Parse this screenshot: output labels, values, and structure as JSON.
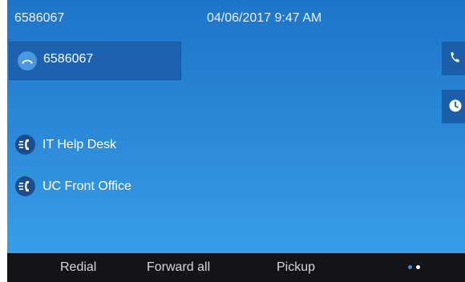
{
  "status_bar": {
    "extension": "6586067",
    "datetime": "04/06/2017 9:47 AM"
  },
  "line_key": {
    "label": "6586067",
    "icon": "handset-icon"
  },
  "features": [
    {
      "label": "IT Help Desk",
      "icon": "line-status-icon"
    },
    {
      "label": "UC Front Office",
      "icon": "line-status-icon"
    }
  ],
  "side_tabs": [
    {
      "icon": "phone-icon"
    },
    {
      "icon": "clock-icon"
    }
  ],
  "softkeys": [
    {
      "label": "Redial"
    },
    {
      "label": "Forward all"
    },
    {
      "label": "Pickup"
    }
  ],
  "page_dots": {
    "count": 2,
    "active": 1
  },
  "colors": {
    "background_top": "#1e74c9",
    "background_bottom": "#3aa3ec",
    "line_key": "#1c62b0",
    "softkey_bar": "#121418"
  }
}
